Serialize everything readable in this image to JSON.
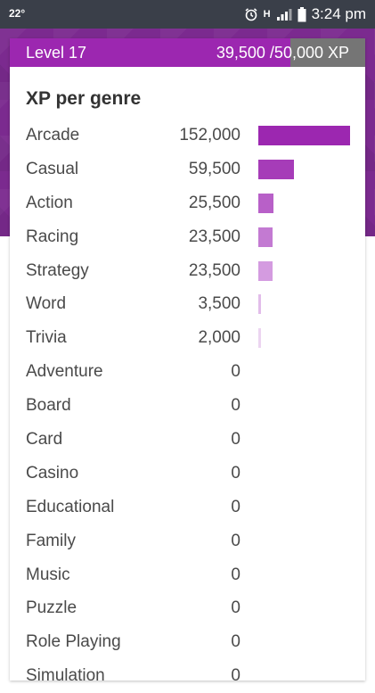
{
  "status": {
    "temperature": "22°",
    "network": "H",
    "time": "3:24 pm"
  },
  "level": {
    "label": "Level 17",
    "xp_text": "39,500 /50,000 XP",
    "progress": 0.79
  },
  "section_title": "XP per genre",
  "colors": {
    "accent": "#9c27b0",
    "header_bg": "#7b2a8f",
    "track": "#757575"
  },
  "bar_max": 152000,
  "genres": [
    {
      "name": "Arcade",
      "xp": "152,000",
      "value": 152000,
      "color": "#9c27b0"
    },
    {
      "name": "Casual",
      "xp": "59,500",
      "value": 59500,
      "color": "#a63cb8"
    },
    {
      "name": "Action",
      "xp": "25,500",
      "value": 25500,
      "color": "#b860c8"
    },
    {
      "name": "Racing",
      "xp": "23,500",
      "value": 23500,
      "color": "#c37ad2"
    },
    {
      "name": "Strategy",
      "xp": "23,500",
      "value": 23500,
      "color": "#d49be0"
    },
    {
      "name": "Word",
      "xp": "3,500",
      "value": 3500,
      "color": "#e2bdea"
    },
    {
      "name": "Trivia",
      "xp": "2,000",
      "value": 2000,
      "color": "#ecd5f1"
    },
    {
      "name": "Adventure",
      "xp": "0",
      "value": 0,
      "color": "#ecd5f1"
    },
    {
      "name": "Board",
      "xp": "0",
      "value": 0,
      "color": "#ecd5f1"
    },
    {
      "name": "Card",
      "xp": "0",
      "value": 0,
      "color": "#ecd5f1"
    },
    {
      "name": "Casino",
      "xp": "0",
      "value": 0,
      "color": "#ecd5f1"
    },
    {
      "name": "Educational",
      "xp": "0",
      "value": 0,
      "color": "#ecd5f1"
    },
    {
      "name": "Family",
      "xp": "0",
      "value": 0,
      "color": "#ecd5f1"
    },
    {
      "name": "Music",
      "xp": "0",
      "value": 0,
      "color": "#ecd5f1"
    },
    {
      "name": "Puzzle",
      "xp": "0",
      "value": 0,
      "color": "#ecd5f1"
    },
    {
      "name": "Role Playing",
      "xp": "0",
      "value": 0,
      "color": "#ecd5f1"
    },
    {
      "name": "Simulation",
      "xp": "0",
      "value": 0,
      "color": "#ecd5f1"
    }
  ]
}
